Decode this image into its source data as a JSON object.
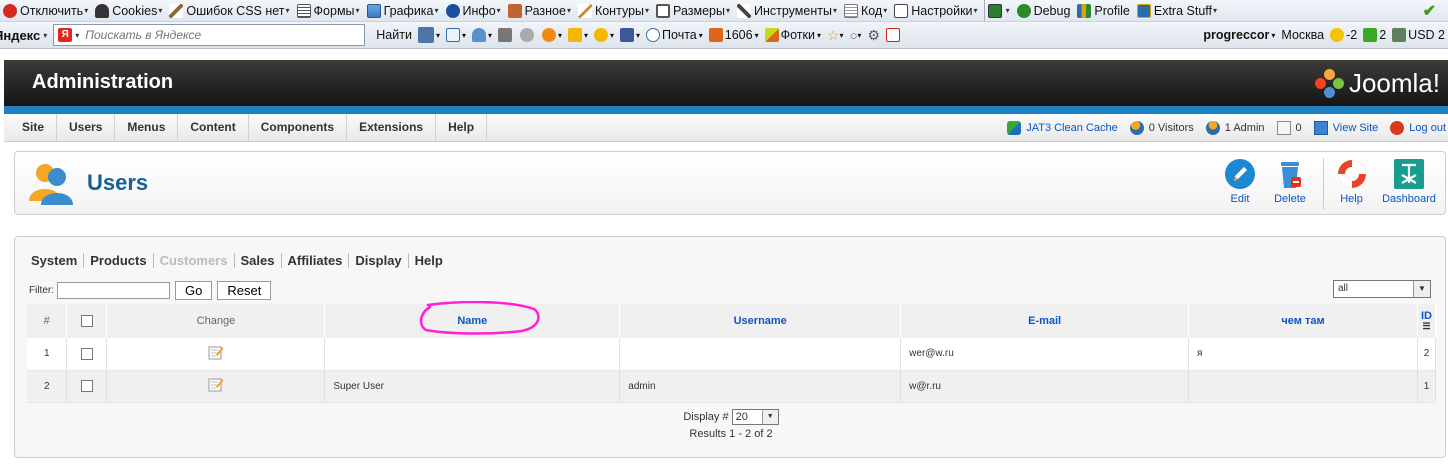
{
  "browser_toolbar": {
    "items": [
      {
        "label": "Отключить",
        "icon": "disable-icon",
        "color": "#d52b1e"
      },
      {
        "label": "Cookies",
        "icon": "cookies-icon",
        "color": "#333333"
      },
      {
        "label": "Ошибок CSS нет",
        "icon": "pencil-icon",
        "color": "#8a6d3b"
      },
      {
        "label": "Формы",
        "icon": "forms-icon",
        "color": "#555555"
      },
      {
        "label": "Графика",
        "icon": "images-icon",
        "color": "#3b7bbf"
      },
      {
        "label": "Инфо",
        "icon": "info-icon",
        "color": "#1d4fa0"
      },
      {
        "label": "Разное",
        "icon": "misc-icon",
        "color": "#c1642d"
      },
      {
        "label": "Контуры",
        "icon": "outline-icon",
        "color": "#c98b2e"
      },
      {
        "label": "Размеры",
        "icon": "resize-icon",
        "color": "#555555"
      },
      {
        "label": "Инструменты",
        "icon": "tools-icon",
        "color": "#444444"
      },
      {
        "label": "Код",
        "icon": "source-icon",
        "color": "#777777"
      },
      {
        "label": "Настройки",
        "icon": "options-icon",
        "color": "#444444"
      },
      {
        "label": "",
        "icon": "monitor-icon",
        "color": "#2d7d2d"
      },
      {
        "label": "Debug",
        "icon": "bug-icon",
        "color": "#2c8a2c"
      },
      {
        "label": "Profile",
        "icon": "profile-icon",
        "color": "#2b6cb0"
      },
      {
        "label": "Extra Stuff",
        "icon": "extra-icon",
        "color": "#2b6cb0"
      }
    ],
    "check_icon": "green-check-icon"
  },
  "yandex_bar": {
    "brand": "Яндекс",
    "search_placeholder": "Поискать в Яндексе",
    "find_label": "Найти",
    "mail_label": "Почта",
    "count": "1606",
    "photos_label": "Фотки",
    "user": "progreccor",
    "city": "Москва",
    "temperature": "-2",
    "traffic": "2",
    "currency": "USD 2"
  },
  "header": {
    "title": "Administration",
    "logo_text": "Joomla!"
  },
  "menu": {
    "items": [
      "Site",
      "Users",
      "Menus",
      "Content",
      "Components",
      "Extensions",
      "Help"
    ]
  },
  "status": {
    "cache": "JAT3 Clean Cache",
    "visitors": "0 Visitors",
    "admins": "1 Admin",
    "messages": "0",
    "view_site": "View Site",
    "logout": "Log out"
  },
  "toolbar": {
    "page_title": "Users",
    "buttons": [
      {
        "label": "Edit",
        "icon": "edit-icon"
      },
      {
        "label": "Delete",
        "icon": "delete-icon"
      },
      {
        "label": "Help",
        "icon": "help-icon"
      },
      {
        "label": "Dashboard",
        "icon": "dashboard-icon"
      }
    ]
  },
  "content": {
    "tabs": [
      {
        "label": "System",
        "dim": false
      },
      {
        "label": "Products",
        "dim": false
      },
      {
        "label": "Customers",
        "dim": true
      },
      {
        "label": "Sales",
        "dim": false
      },
      {
        "label": "Affiliates",
        "dim": false
      },
      {
        "label": "Display",
        "dim": false
      },
      {
        "label": "Help",
        "dim": false
      }
    ],
    "filter": {
      "label": "Filter:",
      "value": "",
      "go_label": "Go",
      "reset_label": "Reset",
      "select_value": "all"
    },
    "columns": [
      "#",
      "",
      "Change",
      "Name",
      "Username",
      "E-mail",
      "чем там",
      "ID"
    ],
    "rows": [
      {
        "num": "1",
        "name": "",
        "username": "",
        "email": "wer@w.ru",
        "extra": "я",
        "id": "2"
      },
      {
        "num": "2",
        "name": "Super User",
        "username": "admin",
        "email": "w@r.ru",
        "extra": "",
        "id": "1"
      }
    ],
    "pager": {
      "display_label": "Display #",
      "display_value": "20",
      "results": "Results 1 - 2 of 2"
    }
  },
  "colors": {
    "accent_blue": "#1e7fc1",
    "title_blue": "#146295",
    "link_blue": "#0b55c4",
    "annotation_magenta": "#ff1fd4"
  }
}
